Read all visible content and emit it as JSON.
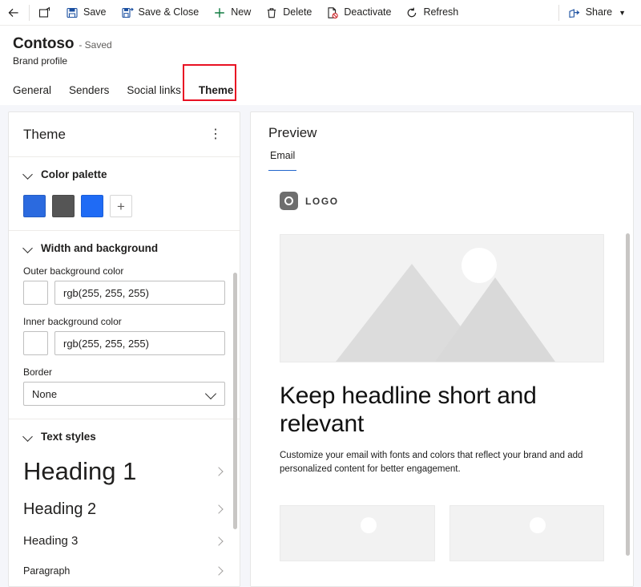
{
  "commandbar": {
    "back": {
      "label": "",
      "icon": "arrow-back-icon"
    },
    "items": [
      {
        "id": "open-record",
        "label": "",
        "icon": "open-record-icon"
      },
      {
        "id": "save",
        "label": "Save",
        "icon": "save-icon"
      },
      {
        "id": "save-and-close",
        "label": "Save & Close",
        "icon": "save-and-close-icon"
      },
      {
        "id": "new",
        "label": "New",
        "icon": "plus-icon"
      },
      {
        "id": "delete",
        "label": "Delete",
        "icon": "trash-icon"
      },
      {
        "id": "deactivate",
        "label": "Deactivate",
        "icon": "deactivate-icon"
      },
      {
        "id": "refresh",
        "label": "Refresh",
        "icon": "refresh-icon"
      }
    ],
    "share": {
      "label": "Share",
      "icon": "share-icon",
      "chevron": "chevron-down-icon"
    }
  },
  "header": {
    "title": "Contoso",
    "saved_state": "- Saved",
    "subtitle": "Brand profile"
  },
  "tabs": [
    {
      "label": "General",
      "selected": false
    },
    {
      "label": "Senders",
      "selected": false
    },
    {
      "label": "Social links",
      "selected": false
    },
    {
      "label": "Theme",
      "selected": true
    }
  ],
  "left_panel": {
    "title": "Theme",
    "more_label": "⋮",
    "sections": {
      "color_palette": {
        "title": "Color palette",
        "swatches": [
          "#2b6adf",
          "#555555",
          "#1f6bf5"
        ],
        "add_label": "+"
      },
      "width_background": {
        "title": "Width and background",
        "outer_label": "Outer background color",
        "outer_value": "rgb(255, 255, 255)",
        "outer_chip": "#ffffff",
        "inner_label": "Inner background color",
        "inner_value": "rgb(255, 255, 255)",
        "inner_chip": "#ffffff",
        "border_label": "Border",
        "border_value": "None"
      },
      "text_styles": {
        "title": "Text styles",
        "items": [
          {
            "label": "Heading 1"
          },
          {
            "label": "Heading 2"
          },
          {
            "label": "Heading 3"
          },
          {
            "label": "Paragraph"
          }
        ]
      }
    }
  },
  "right_panel": {
    "title": "Preview",
    "tabs": [
      {
        "label": "Email",
        "selected": true
      }
    ],
    "email": {
      "logo_text": "LOGO",
      "headline": "Keep headline short and relevant",
      "body": "Customize your email with fonts and colors that reflect your brand and add personalized content for better engagement."
    }
  },
  "colors": {
    "accent": "#2266cc",
    "highlight_box": "#e81123",
    "new_icon_green": "#107c41",
    "deactivate_red": "#d13438",
    "workarea_bg": "#f5f6fa"
  }
}
